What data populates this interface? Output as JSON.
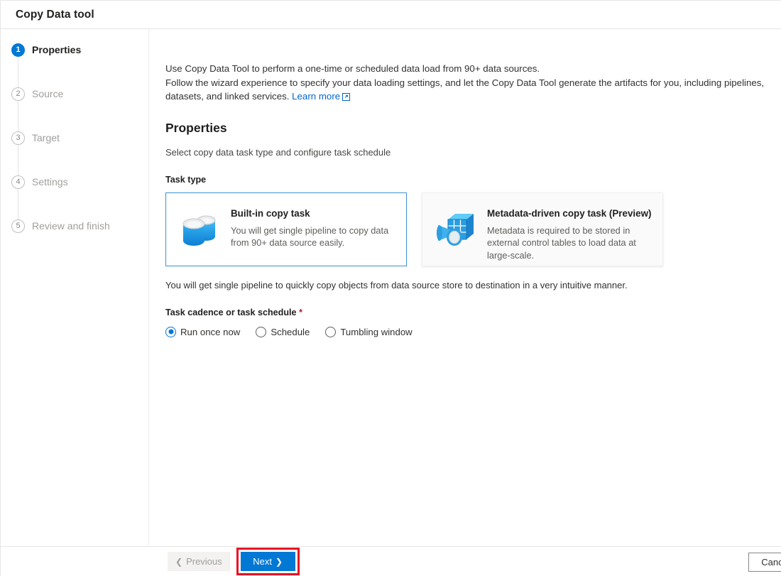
{
  "window": {
    "title": "Copy Data tool"
  },
  "sidebar": {
    "steps": [
      {
        "num": "1",
        "label": "Properties",
        "state": "active"
      },
      {
        "num": "2",
        "label": "Source",
        "state": "idle"
      },
      {
        "num": "3",
        "label": "Target",
        "state": "idle"
      },
      {
        "num": "4",
        "label": "Settings",
        "state": "idle"
      },
      {
        "num": "5",
        "label": "Review and finish",
        "state": "idle"
      }
    ]
  },
  "main": {
    "intro_line1": "Use Copy Data Tool to perform a one-time or scheduled data load from 90+ data sources.",
    "intro_line2": "Follow the wizard experience to specify your data loading settings, and let the Copy Data Tool generate the artifacts for you, including pipelines, datasets, and linked services.",
    "learn_more": "Learn more",
    "learn_more_icon": "external-link-icon",
    "section_title": "Properties",
    "section_subtitle": "Select copy data task type and configure task schedule",
    "task_type_label": "Task type",
    "cards": [
      {
        "title": "Built-in copy task",
        "description": "You will get single pipeline to copy data from 90+ data source easily.",
        "icon": "database-cylinders-icon",
        "selected": true
      },
      {
        "title": "Metadata-driven copy task (Preview)",
        "description": "Metadata is required to be stored in external control tables to load data at large-scale.",
        "icon": "metadata-table-search-icon",
        "selected": false
      }
    ],
    "hint": "You will get single pipeline to quickly copy objects from data source store to destination in a very intuitive manner.",
    "cadence_label": "Task cadence or task schedule",
    "required_marker": "*",
    "cadence_options": [
      {
        "label": "Run once now",
        "checked": true
      },
      {
        "label": "Schedule",
        "checked": false
      },
      {
        "label": "Tumbling window",
        "checked": false
      }
    ]
  },
  "footer": {
    "previous_label": "Previous",
    "previous_chevron": "chevron-left-icon",
    "next_label": "Next",
    "next_chevron": "chevron-right-icon",
    "cancel_label": "Cancel"
  },
  "colors": {
    "accent": "#0078d4",
    "selected_border": "#3b92d4",
    "link": "#0066cc",
    "highlight": "#e81123",
    "required": "#a4262c"
  }
}
